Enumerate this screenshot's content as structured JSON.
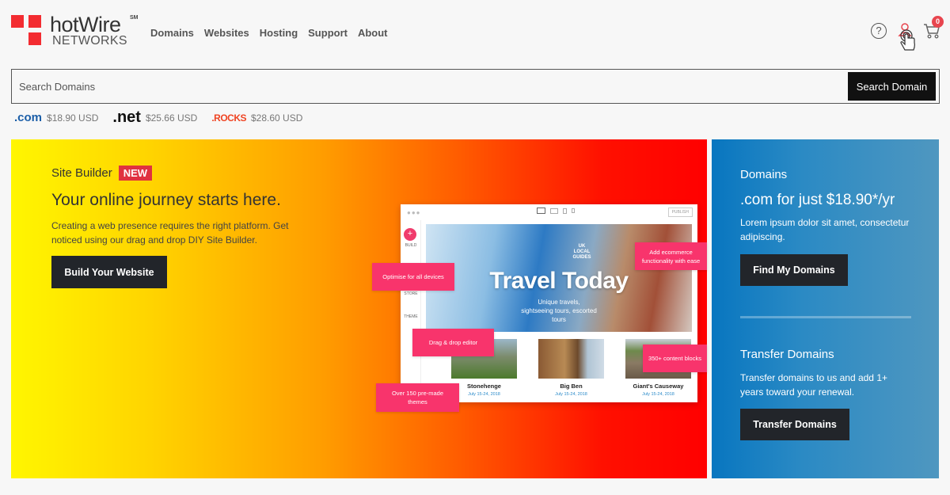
{
  "brand": {
    "name": "hotWire",
    "trademark": "SM",
    "sub": "NETWORKS",
    "color": "#f32c31"
  },
  "nav": {
    "items": [
      {
        "label": "Domains"
      },
      {
        "label": "Websites"
      },
      {
        "label": "Hosting"
      },
      {
        "label": "Support"
      },
      {
        "label": "About"
      }
    ]
  },
  "header_icons": {
    "help": "help-circle-icon",
    "user": "user-icon",
    "cart": "cart-icon",
    "cart_count": "0"
  },
  "search": {
    "placeholder": "Search Domains",
    "value": "",
    "button_label": "Search Domain"
  },
  "tlds": [
    {
      "name": ".com",
      "price": "$18.90 USD"
    },
    {
      "name": ".net",
      "price": "$25.66 USD"
    },
    {
      "name": ".ROCKS",
      "price": "$28.60 USD"
    }
  ],
  "hero": {
    "label": "Site Builder",
    "badge": "NEW",
    "title": "Your online journey starts here.",
    "text": "Creating a web presence requires the right platform. Get noticed using our drag and drop DIY Site Builder.",
    "button_label": "Build Your Website",
    "mockup": {
      "publish": "PUBLISH",
      "side_labels": [
        "BUILD",
        "STORE",
        "THEME"
      ],
      "guide_logo": "UK LOCAL GUIDES",
      "headline": "Travel Today",
      "subline": "Unique travels, sightseeing tours, escorted tours",
      "cards": [
        {
          "name": "Stonehenge",
          "date": "July 15-24, 2018"
        },
        {
          "name": "Big Ben",
          "date": "July 15-24, 2018"
        },
        {
          "name": "Giant's Causeway",
          "date": "July 15-24, 2018"
        }
      ],
      "callouts": {
        "devices": "Optimise for all devices",
        "ecommerce": "Add ecommerce functionality with ease",
        "dragdrop": "Drag & drop editor",
        "blocks": "350+ content blocks",
        "themes": "Over 150 pre-made themes"
      }
    }
  },
  "domains_panel": {
    "title": "Domains",
    "offer": ".com for just $18.90*/yr",
    "text": "Lorem ipsum dolor sit amet, consectetur adipiscing.",
    "button_label": "Find My Domains",
    "transfer_title": "Transfer Domains",
    "transfer_text": "Transfer domains to us and add 1+ years toward your renewal.",
    "transfer_button_label": "Transfer Domains"
  }
}
